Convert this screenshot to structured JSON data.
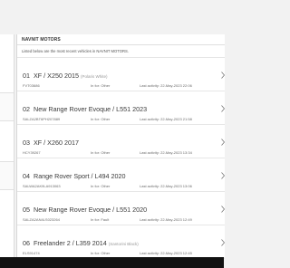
{
  "panel": {
    "title": "NAVNIT MOTORS",
    "description": "Listed below are the most recent vehicles in NAVNIT MOTORS."
  },
  "vehicles": [
    {
      "number": "01",
      "name": "XF / X250 2015",
      "colour": "(Polaris White)",
      "vin": "FVT03686",
      "status": "In for: Other",
      "activity": "Last activity: 22-May-2023 22:06"
    },
    {
      "number": "02",
      "name": "New Range Rover Evoque / L551 2023",
      "colour": "",
      "vin": "SALZA2BT6PH207889",
      "status": "In for: Other",
      "activity": "Last activity: 22-May-2023 21:58"
    },
    {
      "number": "03",
      "name": "XF / X260 2017",
      "colour": "",
      "vin": "HCY39267",
      "status": "In for: Other",
      "activity": "Last activity: 22-May-2023 13:34"
    },
    {
      "number": "04",
      "name": "Range Rover Sport / L494 2020",
      "colour": "",
      "vin": "SALWA2AK9LA913063",
      "status": "In for: Other",
      "activity": "Last activity: 22-May-2023 13:06"
    },
    {
      "number": "05",
      "name": "New Range Rover Evoque / L551 2020",
      "colour": "",
      "vin": "SALZA2AN4LS023264",
      "status": "In for: Fault",
      "activity": "Last activity: 22-May-2023 12:49"
    },
    {
      "number": "06",
      "name": "Freelander 2 / L359 2014",
      "colour": "(Santorini Black)",
      "vin": "ELS91474",
      "status": "In for: Other",
      "activity": "Last activity: 22-May-2023 12:45"
    }
  ]
}
